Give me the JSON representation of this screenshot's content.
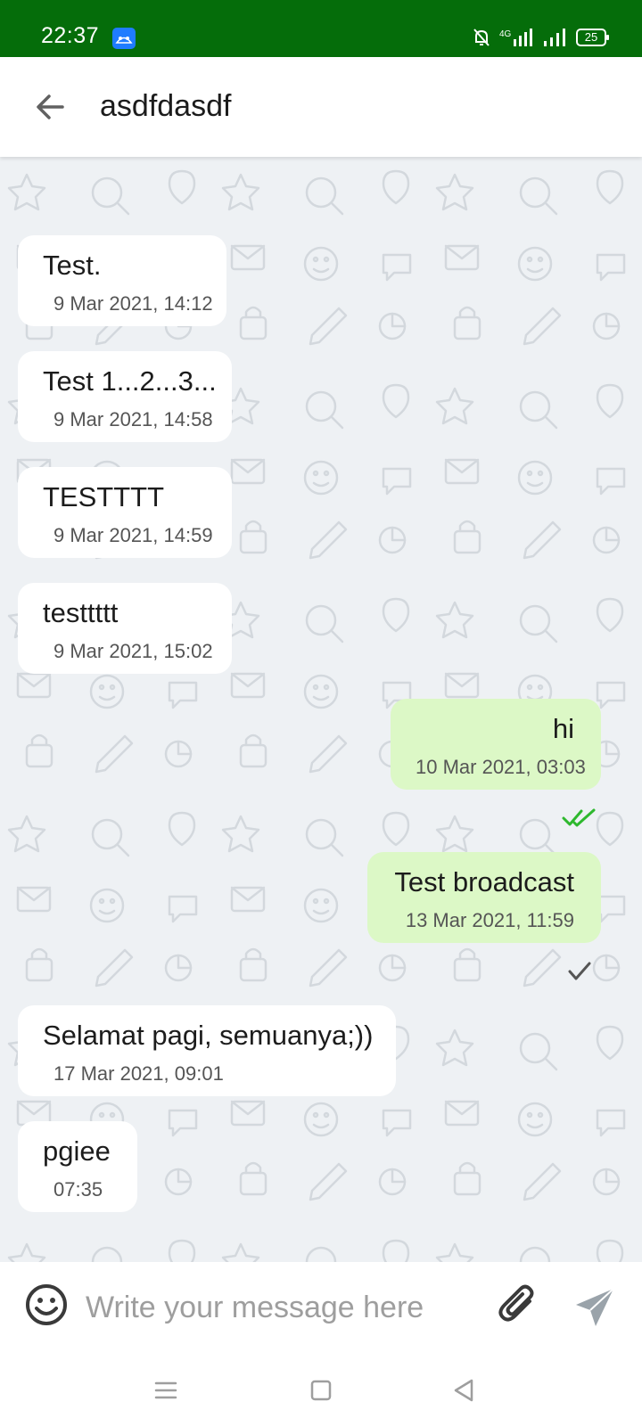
{
  "status_bar": {
    "time": "22:37",
    "battery": "25",
    "icons": [
      "app-icon",
      "mute-icon",
      "signal-4g-icon",
      "signal-icon",
      "battery-icon"
    ]
  },
  "header": {
    "title": "asdfdasdf",
    "back_icon": "arrow-back-icon"
  },
  "messages": [
    {
      "direction": "in",
      "text": "Test.",
      "time": "9 Mar 2021, 14:12"
    },
    {
      "direction": "in",
      "text": "Test 1...2...3...",
      "time": "9 Mar 2021, 14:58"
    },
    {
      "direction": "in",
      "text": "TESTTTT",
      "time": "9 Mar 2021, 14:59"
    },
    {
      "direction": "in",
      "text": "testtttt",
      "time": "9 Mar 2021, 15:02"
    },
    {
      "direction": "out",
      "text": "hi",
      "time": "10 Mar 2021, 03:03",
      "status": "read"
    },
    {
      "direction": "out",
      "text": "Test broadcast",
      "time": "13 Mar 2021, 11:59",
      "status": "sent"
    },
    {
      "direction": "in",
      "text": "Selamat pagi, semuanya;))",
      "time": "17 Mar 2021, 09:01"
    },
    {
      "direction": "in",
      "text": "pgiee",
      "time": "07:35"
    }
  ],
  "input_bar": {
    "placeholder": "Write your message here",
    "value": "",
    "icons": [
      "emoji-icon",
      "attach-icon",
      "send-icon"
    ]
  },
  "nav_bar": {
    "icons": [
      "menu-icon",
      "home-icon",
      "back-triangle-icon"
    ]
  },
  "colors": {
    "status_bar": "#056d0a",
    "outgoing_bubble": "#dcf8c6",
    "incoming_bubble": "#ffffff",
    "chat_background": "#eef1f4",
    "read_tick": "#2eb82e"
  }
}
